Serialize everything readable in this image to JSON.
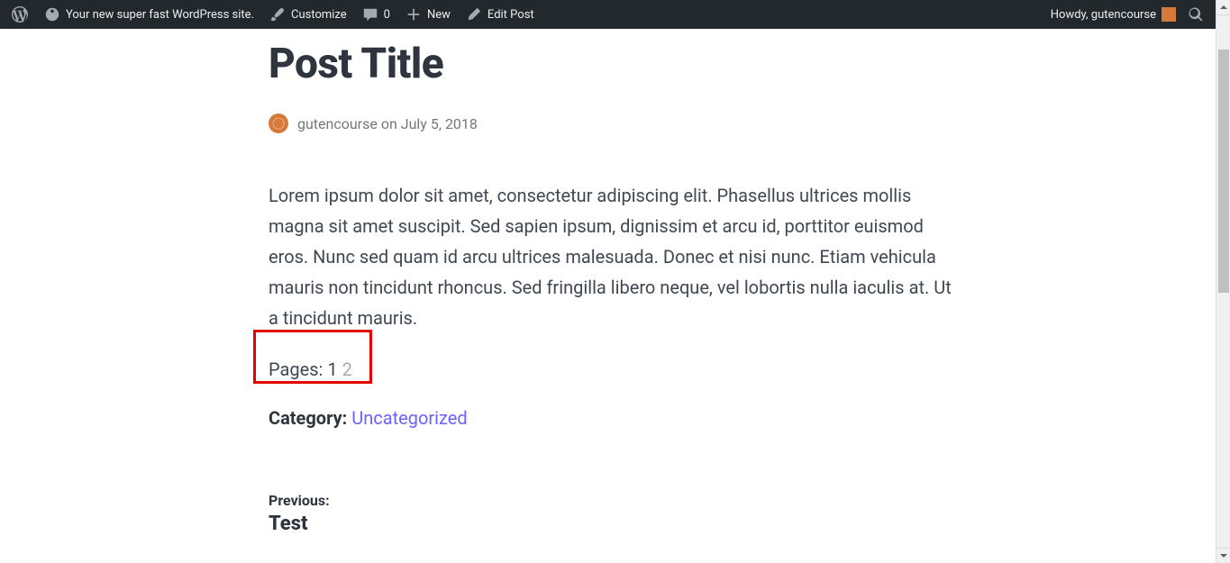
{
  "adminbar": {
    "site_name": "Your new super fast WordPress site.",
    "customize": "Customize",
    "comments_count": "0",
    "new": "New",
    "edit_post": "Edit Post",
    "howdy": "Howdy, gutencourse"
  },
  "post": {
    "title": "Post Title",
    "author": "gutencourse",
    "byline_sep": "on",
    "date": "July 5, 2018",
    "body": "Lorem ipsum dolor sit amet, consectetur adipiscing elit. Phasellus ultrices mollis magna sit amet suscipit. Sed sapien ipsum, dignissim et arcu id, porttitor euismod eros. Nunc sed quam id arcu ultrices malesuada. Donec et nisi nunc. Etiam vehicula mauris non tincidunt rhoncus. Sed fringilla libero neque, vel lobortis nulla iaculis at. Ut a tincidunt mauris.",
    "pages_label": "Pages:",
    "pages_current": "1",
    "pages_other": "2",
    "category_label": "Category:",
    "category_value": "Uncategorized",
    "previous_label": "Previous:",
    "previous_title": "Test"
  }
}
